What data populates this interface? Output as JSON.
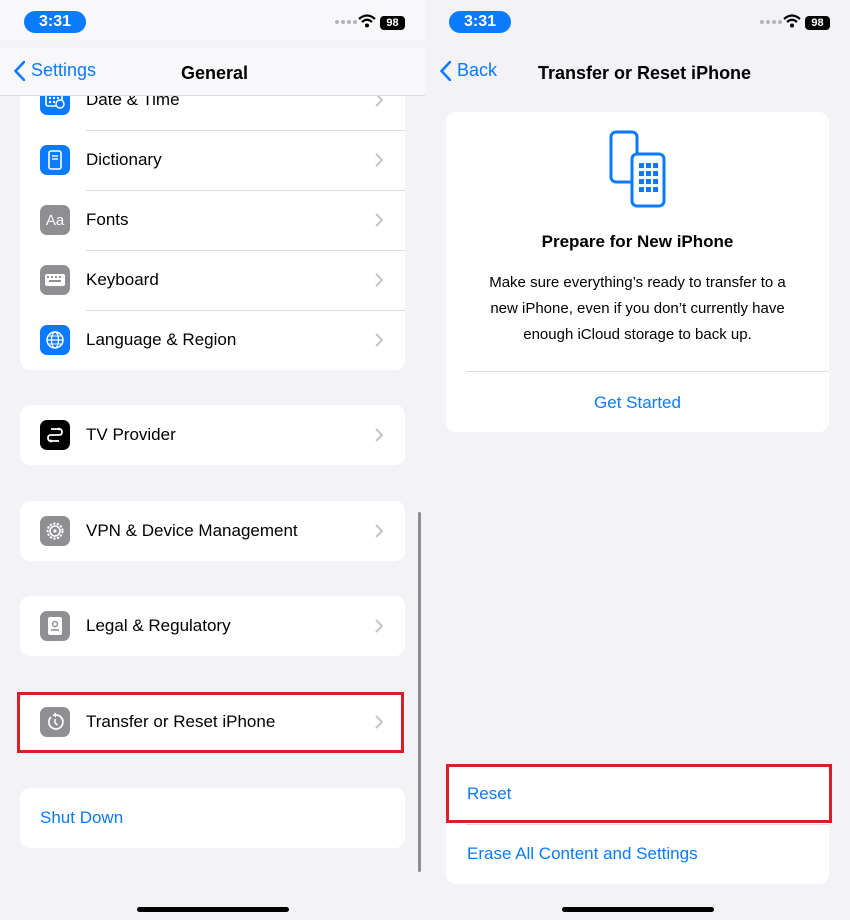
{
  "status": {
    "time": "3:31",
    "battery": "98"
  },
  "left": {
    "back_label": "Settings",
    "title": "General",
    "group1": [
      {
        "label": "Date & Time",
        "icon": "calendar-clock-icon"
      },
      {
        "label": "Dictionary",
        "icon": "book-icon"
      },
      {
        "label": "Fonts",
        "icon": "fonts-icon",
        "glyph": "Aa"
      },
      {
        "label": "Keyboard",
        "icon": "keyboard-icon"
      },
      {
        "label": "Language & Region",
        "icon": "globe-icon"
      }
    ],
    "tv_provider": "TV Provider",
    "vpn": "VPN & Device Management",
    "legal": "Legal & Regulatory",
    "transfer": "Transfer or Reset iPhone",
    "shut_down": "Shut Down"
  },
  "right": {
    "back_label": "Back",
    "title": "Transfer or Reset iPhone",
    "prepare_title": "Prepare for New iPhone",
    "prepare_description": "Make sure everything’s ready to transfer to a new iPhone, even if you don’t currently have enough iCloud storage to back up.",
    "get_started": "Get Started",
    "reset": "Reset",
    "erase": "Erase All Content and Settings"
  },
  "colors": {
    "accent": "#0a7aff",
    "highlight": "#d62027"
  }
}
